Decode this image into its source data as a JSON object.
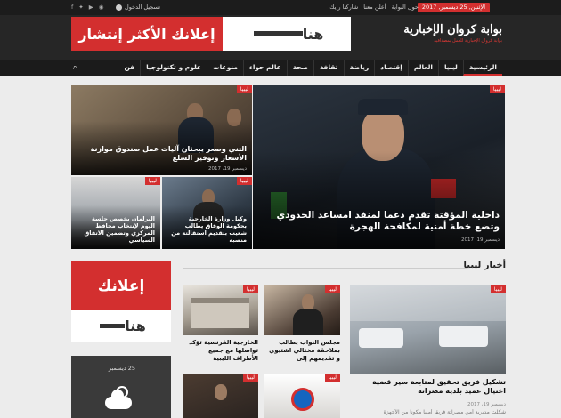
{
  "topbar": {
    "date": "الإثنين, 25 ديسمبر, 2017",
    "links": [
      "حول البوابة",
      "أعلن معنا",
      "شاركنا رأيك"
    ],
    "login": "تسجيل الدخول"
  },
  "header": {
    "logo_main": "بوابة كروان الإخبارية",
    "logo_sub": "بوابة كروان الإخبارية للعمل بمصداقية",
    "ad_red": "إعلانك الأكثر إنتشار",
    "ad_white": "هنا"
  },
  "nav": {
    "items": [
      "الرئيسية",
      "ليبيا",
      "العالم",
      "إقتصاد",
      "رياضة",
      "ثقافة",
      "صحة",
      "عالم حواء",
      "منوعات",
      "علوم و تكنولوجيا",
      "فن"
    ],
    "search_icon": "search-icon"
  },
  "hero": {
    "main": {
      "tag": "ليبيا",
      "title": "داخلية المؤقتة تقدم دعما لمنفذ امساعد الحدودي وتضع خطة أمنية لمكافحة الهجرة",
      "date": "ديسمبر 19، 2017"
    },
    "top_right": {
      "tag": "ليبيا",
      "title": "الثني وصعر يبحثان آليات عمل صندوق موازنة الأسعار وتوفير السلع",
      "date": "ديسمبر 19، 2017"
    },
    "bottom_left": {
      "tag": "ليبيا",
      "title": "البرلمان يخصص جلسة اليوم لإنتخاب محافظ المركزي وتضمين الاتفاق السياسي"
    },
    "bottom_mid": {
      "tag": "ليبيا",
      "title": "وكيل وزارة الخارجية بحكومة الوفاق يطالب شعيب بتقديم استقالته من منصبه"
    }
  },
  "sidebar": {
    "ad_red": "إعلانك",
    "ad_white": "هنا",
    "weather_date": "25 ديسمبر",
    "weather_icon": "partly-cloudy-icon"
  },
  "section": {
    "title": "أخبار ليبيا",
    "big": {
      "tag": "ليبيا",
      "title": "تشكيل فريق تحقيق لمتابعة سير قضية اغتيال عميد بلدية مصراتة",
      "date": "ديسمبر 19، 2017",
      "excerpt": "شكلت مديرية أمن مصراتة فريقاً أمنياً مكوناً من الأجهزة"
    },
    "thumbs": [
      {
        "tag": "ليبيا",
        "title": "مجلس النواب يطالب بملاحقة مختالي اشتيوي و تقديمهم إلى"
      },
      {
        "tag": "ليبيا",
        "title": "الخارجية الفرنسية تؤكد تواصلها مع جميع الأطراف الليبية"
      },
      {
        "tag": "ليبيا",
        "title": ""
      },
      {
        "tag": "ليبيا",
        "title": ""
      }
    ]
  },
  "colors": {
    "accent": "#d32f2f",
    "dark": "#262626",
    "nav": "#1b1b1b",
    "bg": "#ececec"
  }
}
